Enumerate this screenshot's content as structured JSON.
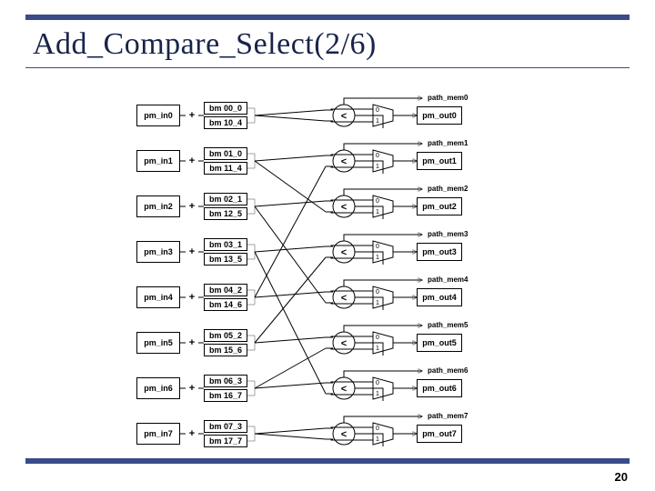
{
  "slide": {
    "title": "Add_Compare_Select(2/6)",
    "page_number": "20"
  },
  "rows": [
    {
      "pm_in": "pm_in0",
      "bm_top": "bm 00_0",
      "bm_bot": "bm 10_4",
      "path_mem": "path_mem0",
      "pm_out": "pm_out0",
      "cmp": "<",
      "plus": "+",
      "mux0": "0",
      "mux1": "1"
    },
    {
      "pm_in": "pm_in1",
      "bm_top": "bm 01_0",
      "bm_bot": "bm 11_4",
      "path_mem": "path_mem1",
      "pm_out": "pm_out1",
      "cmp": "<",
      "plus": "+",
      "mux0": "0",
      "mux1": "1"
    },
    {
      "pm_in": "pm_in2",
      "bm_top": "bm 02_1",
      "bm_bot": "bm 12_5",
      "path_mem": "path_mem2",
      "pm_out": "pm_out2",
      "cmp": "<",
      "plus": "+",
      "mux0": "0",
      "mux1": "1"
    },
    {
      "pm_in": "pm_in3",
      "bm_top": "bm 03_1",
      "bm_bot": "bm 13_5",
      "path_mem": "path_mem3",
      "pm_out": "pm_out3",
      "cmp": "<",
      "plus": "+",
      "mux0": "0",
      "mux1": "1"
    },
    {
      "pm_in": "pm_in4",
      "bm_top": "bm 04_2",
      "bm_bot": "bm 14_6",
      "path_mem": "path_mem4",
      "pm_out": "pm_out4",
      "cmp": "<",
      "plus": "+",
      "mux0": "0",
      "mux1": "1"
    },
    {
      "pm_in": "pm_in5",
      "bm_top": "bm 05_2",
      "bm_bot": "bm 15_6",
      "path_mem": "path_mem5",
      "pm_out": "pm_out5",
      "cmp": "<",
      "plus": "+",
      "mux0": "0",
      "mux1": "1"
    },
    {
      "pm_in": "pm_in6",
      "bm_top": "bm 06_3",
      "bm_bot": "bm 16_7",
      "path_mem": "path_mem6",
      "pm_out": "pm_out6",
      "cmp": "<",
      "plus": "+",
      "mux0": "0",
      "mux1": "1"
    },
    {
      "pm_in": "pm_in7",
      "bm_top": "bm 07_3",
      "bm_bot": "bm 17_7",
      "path_mem": "path_mem7",
      "pm_out": "pm_out7",
      "cmp": "<",
      "plus": "+",
      "mux0": "0",
      "mux1": "1"
    }
  ],
  "butterfly_map": [
    0,
    2,
    4,
    6,
    1,
    3,
    5,
    7
  ]
}
